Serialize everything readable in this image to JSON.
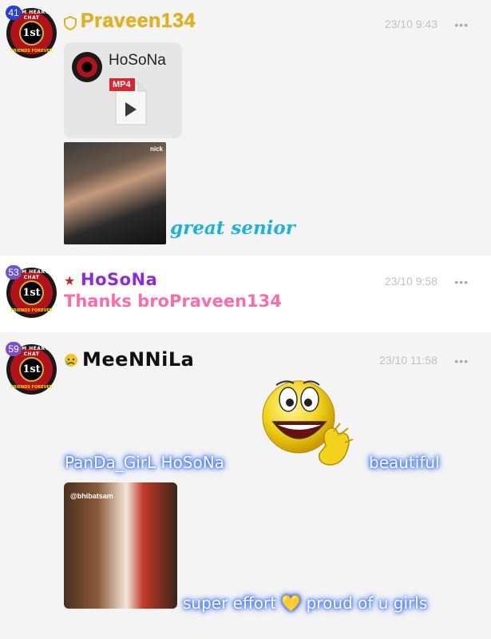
{
  "posts": [
    {
      "level": "41",
      "username": "Praveen134",
      "time": "23/10 9:43",
      "more": "•••",
      "file_card": {
        "title": "HoSoNa",
        "file_type": "MP4"
      },
      "gif_tag": "nick",
      "message": "great senior"
    },
    {
      "level": "53",
      "username": "HoSoNa",
      "time": "23/10 9:58",
      "more": "•••",
      "message": "Thanks broPraveen134"
    },
    {
      "level": "59",
      "username": "MeeNNiLa",
      "time": "23/10 11:58",
      "more": "•••",
      "line1_left": "PanDa_GirL HoSoNa",
      "line1_right": "beautiful",
      "gif_tag": "@bhibatsam",
      "line2": "super effort 💛 proud of u girls"
    }
  ],
  "avatar": {
    "arc_top": "FAM HEART CHAT",
    "center": "1st",
    "arc_bottom": "FRIENDS FOREVER"
  },
  "colors": {
    "level_41": "#2b3fd6",
    "level_53": "#6f56c8",
    "level_59": "#7b4fc9",
    "praveen_name": "#e0b21a",
    "hosona_name": "#8a2be2",
    "meennila_name": "#111111",
    "great_text": "#1ab3d9",
    "thanks_text": "#ff6aa8",
    "glow": "#2563ff"
  },
  "icons": {
    "role_1": "shield-icon",
    "role_2": "star-icon",
    "role_3": "crying-face-icon",
    "emoji": "clapping-smiley-icon"
  }
}
